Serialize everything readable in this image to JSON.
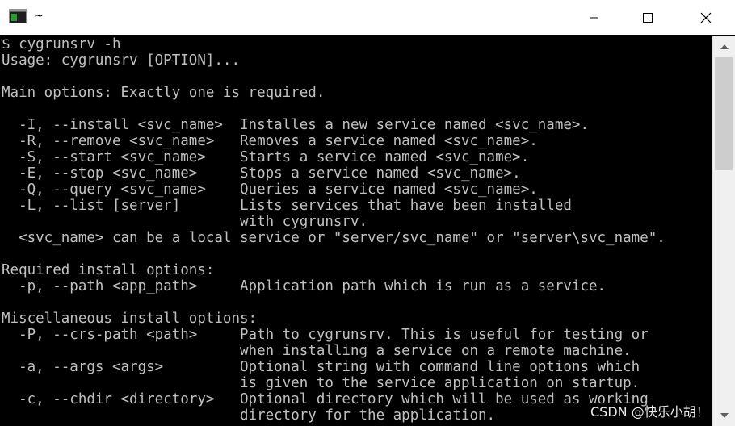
{
  "window": {
    "title": "~",
    "icons": {
      "app": "terminal-icon",
      "minimize": "minimize-icon",
      "maximize": "maximize-icon",
      "close": "close-icon",
      "scroll_up": "chevron-up-icon",
      "scroll_down": "chevron-down-icon"
    },
    "controls": {
      "minimize": "—",
      "maximize": "☐",
      "close": "✕"
    }
  },
  "terminal": {
    "lines": [
      "$ cygrunsrv -h",
      "Usage: cygrunsrv [OPTION]...",
      "",
      "Main options: Exactly one is required.",
      "",
      "  -I, --install <svc_name>  Installes a new service named <svc_name>.",
      "  -R, --remove <svc_name>   Removes a service named <svc_name>.",
      "  -S, --start <svc_name>    Starts a service named <svc_name>.",
      "  -E, --stop <svc_name>     Stops a service named <svc_name>.",
      "  -Q, --query <svc_name>    Queries a service named <svc_name>.",
      "  -L, --list [server]       Lists services that have been installed",
      "                            with cygrunsrv.",
      "  <svc_name> can be a local service or \"server/svc_name\" or \"server\\svc_name\".",
      "",
      "Required install options:",
      "  -p, --path <app_path>     Application path which is run as a service.",
      "",
      "Miscellaneous install options:",
      "  -P, --crs-path <path>     Path to cygrunsrv. This is useful for testing or",
      "                            when installing a service on a remote machine.",
      "  -a, --args <args>         Optional string with command line options which",
      "                            is given to the service application on startup.",
      "  -c, --chdir <directory>   Optional directory which will be used as working",
      "                            directory for the application."
    ]
  },
  "watermark": "CSDN @快乐小胡！",
  "colors": {
    "terminal_bg": "#000000",
    "terminal_fg": "#c0c0c0",
    "titlebar_bg": "#ffffff"
  }
}
